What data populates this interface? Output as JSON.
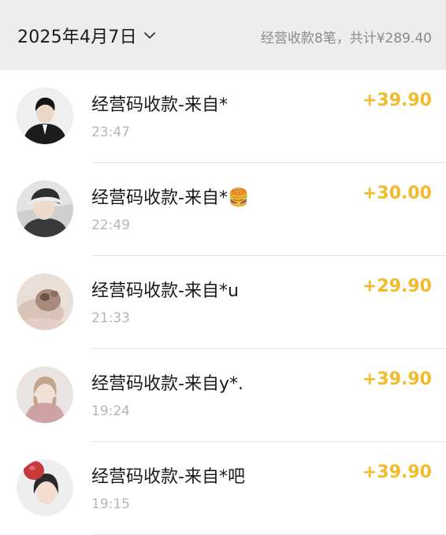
{
  "header": {
    "date": "2025年4月7日",
    "summary": "经营收款8笔，共计¥289.40"
  },
  "transactions": [
    {
      "title": "经营码收款-来自*",
      "time": "23:47",
      "amount": "+39.90",
      "avatar": "avatar-man-dark-suit"
    },
    {
      "title": "经营码收款-来自*🍔",
      "time": "22:49",
      "amount": "+30.00",
      "avatar": "avatar-girl-cap"
    },
    {
      "title": "经营码收款-来自*u",
      "time": "21:33",
      "amount": "+29.90",
      "avatar": "avatar-cat-pink"
    },
    {
      "title": "经营码收款-来自y*.",
      "time": "19:24",
      "amount": "+39.90",
      "avatar": "avatar-girl-pink-dress"
    },
    {
      "title": "经营码收款-来自*吧",
      "time": "19:15",
      "amount": "+39.90",
      "avatar": "avatar-girl-red-bow"
    }
  ],
  "colors": {
    "amount": "#f2bb2c",
    "header_bg": "#ededed",
    "time": "#b5b5b5"
  }
}
